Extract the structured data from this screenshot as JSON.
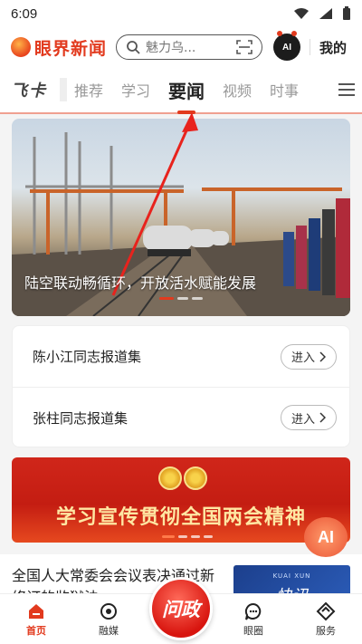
{
  "status_bar": {
    "time": "6:09"
  },
  "header": {
    "logo_text": "眼界新闻",
    "search_placeholder": "魅力乌...",
    "ai_badge": "AI",
    "mine_label": "我的"
  },
  "tabs": {
    "feika": "飞卡",
    "items": [
      {
        "label": "推荐"
      },
      {
        "label": "学习"
      },
      {
        "label": "要闻",
        "active": true
      },
      {
        "label": "视频"
      },
      {
        "label": "时事"
      }
    ]
  },
  "hero": {
    "caption": "陆空联动畅循环，开放活水赋能发展"
  },
  "reports": [
    {
      "title": "陈小江同志报道集",
      "button": "进入"
    },
    {
      "title": "张柱同志报道集",
      "button": "进入"
    }
  ],
  "promo": {
    "title": "学习宣传贯彻全国两会精神"
  },
  "float_ai": {
    "label": "AI"
  },
  "news": {
    "title": "全国人大常委会会议表决通过新修订的监狱法",
    "thumb_small": "KUAI XUN",
    "thumb_big": "快讯"
  },
  "bottom_nav": {
    "items": [
      {
        "label": "首页",
        "icon": "home-icon",
        "active": true
      },
      {
        "label": "融媒",
        "icon": "media-icon"
      },
      {
        "label": "眼圈",
        "icon": "chat-icon"
      },
      {
        "label": "服务",
        "icon": "service-icon"
      }
    ],
    "center_label": "问政"
  },
  "colors": {
    "brand": "#e23a1e",
    "accent_gold": "#ffe7a3"
  }
}
